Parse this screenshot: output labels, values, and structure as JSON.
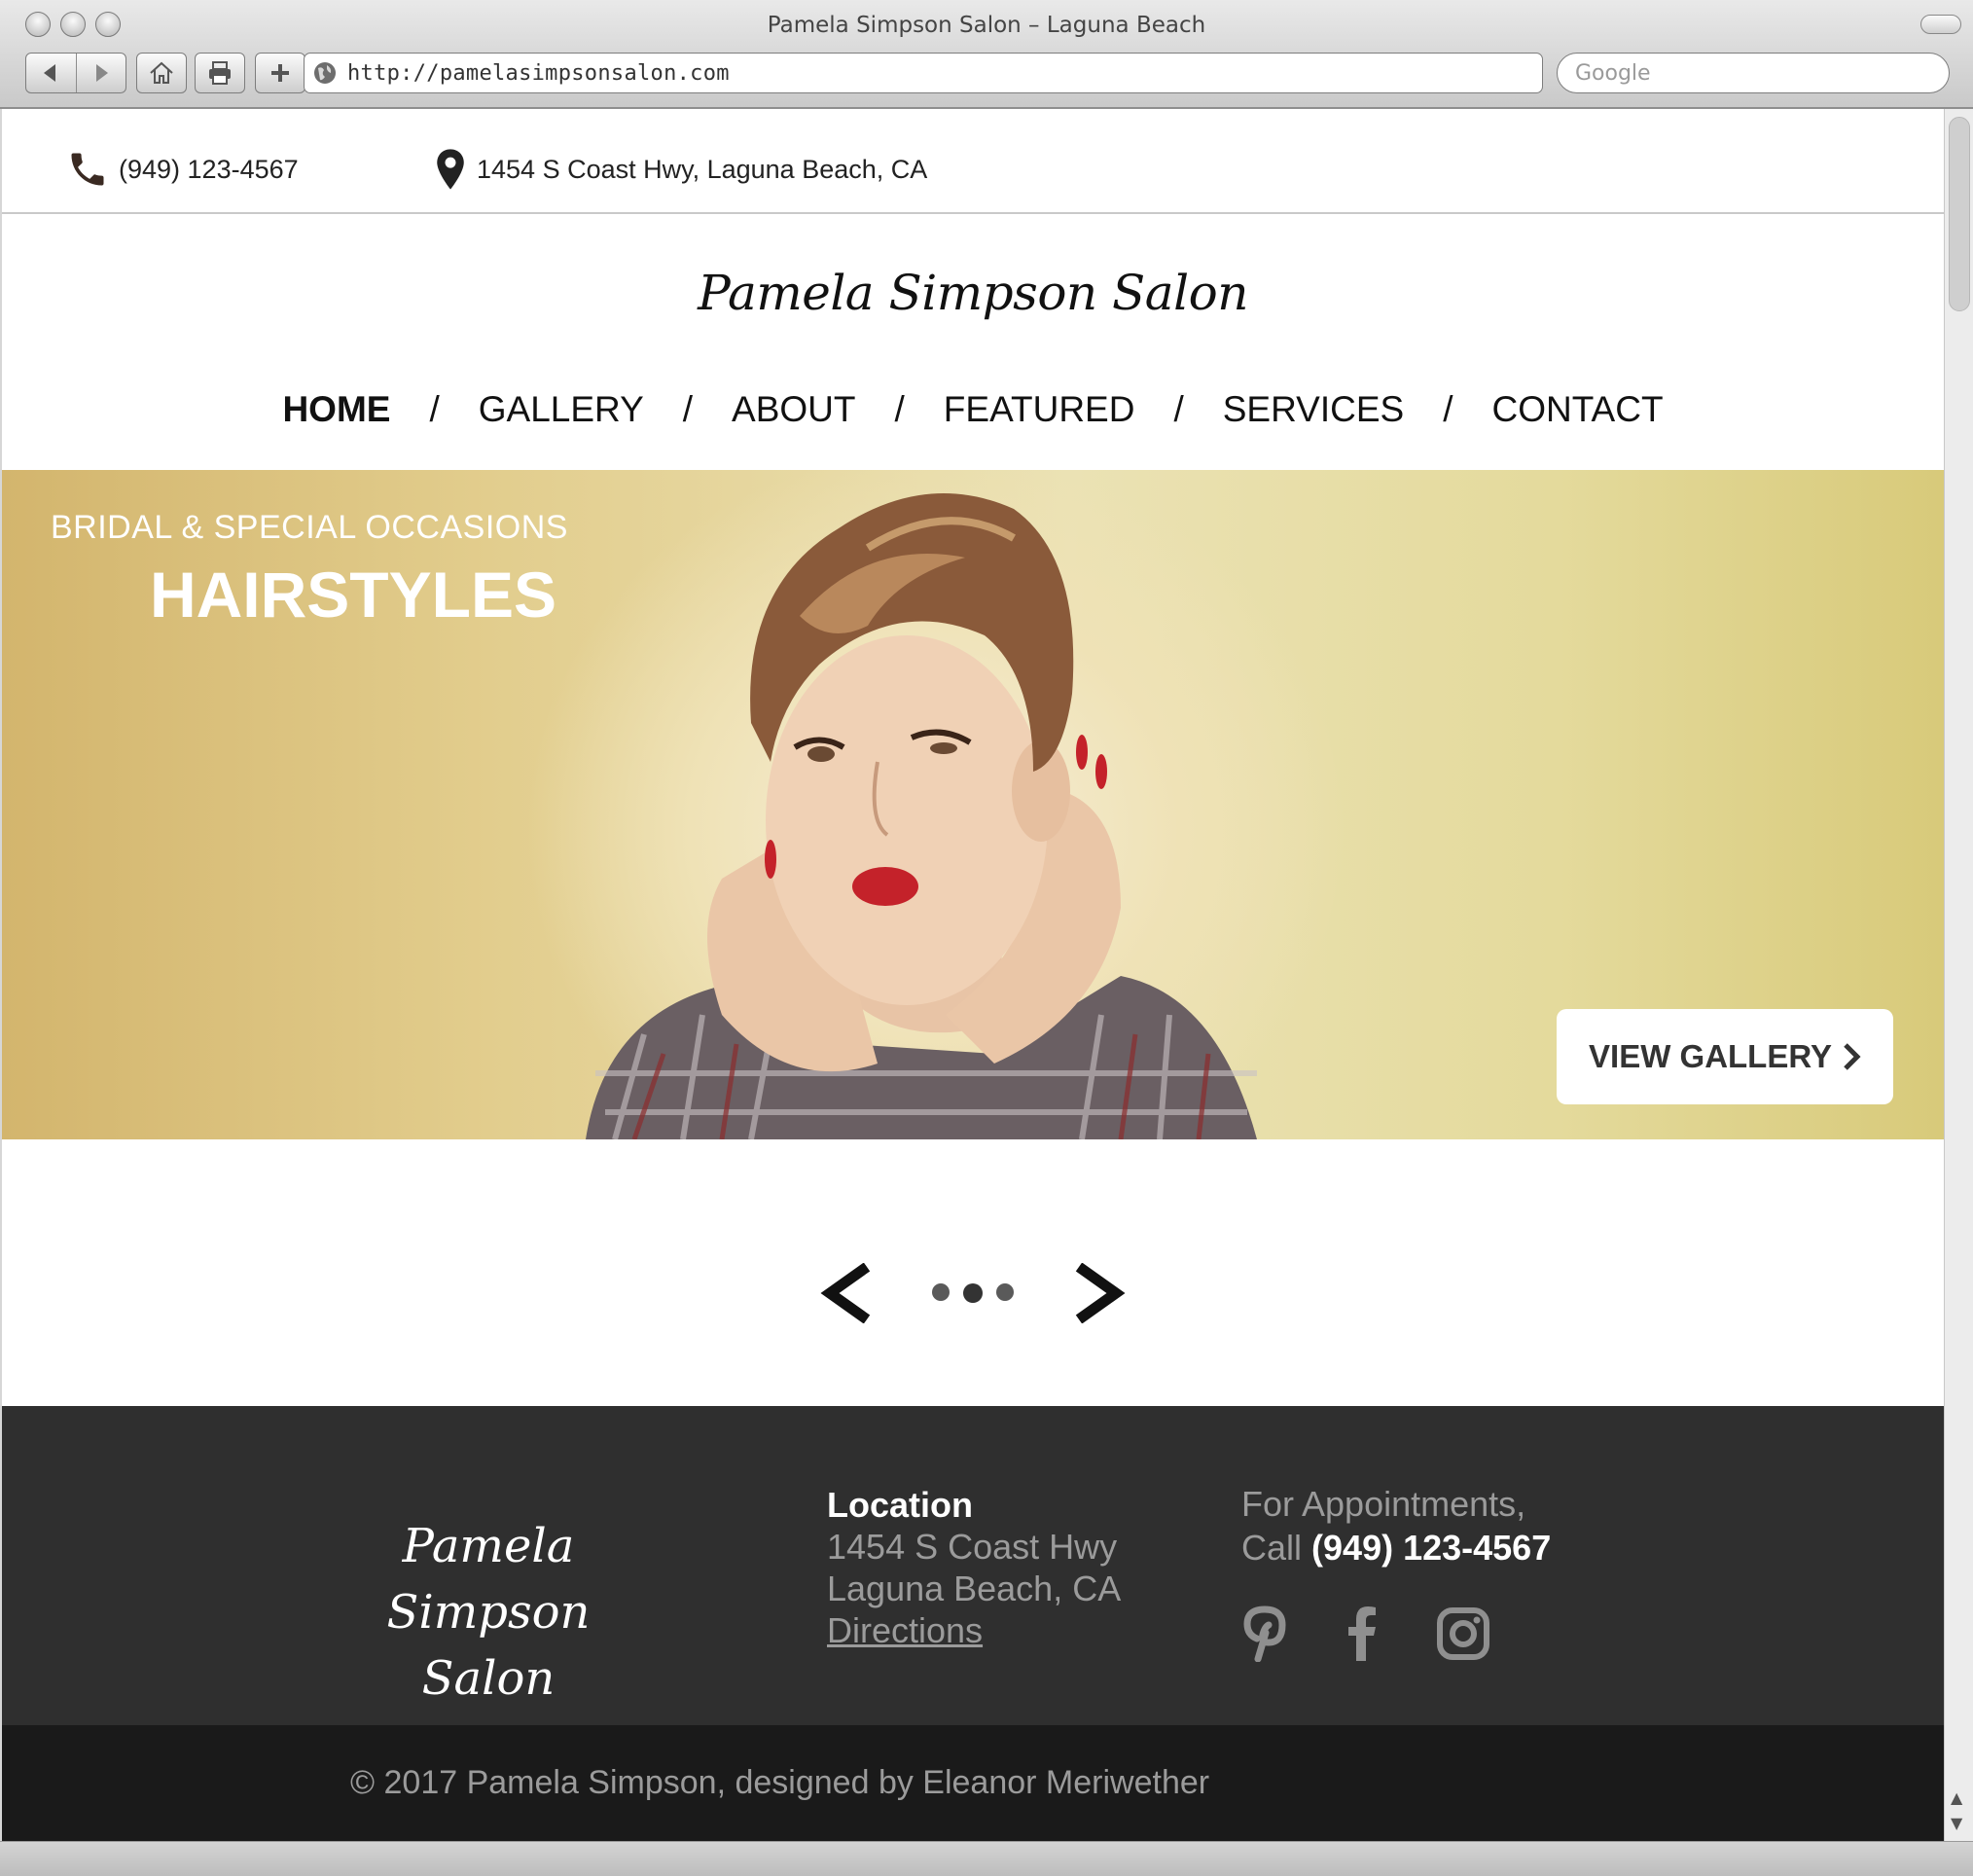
{
  "window": {
    "title": "Pamela Simpson Salon – Laguna Beach",
    "url": "http://pamelasimpsonsalon.com",
    "search_placeholder": "Google"
  },
  "topbar": {
    "phone": "(949) 123-4567",
    "address": "1454 S Coast Hwy, Laguna Beach, CA"
  },
  "site": {
    "logo": "Pamela Simpson Salon"
  },
  "nav": {
    "items": [
      {
        "label": "HOME",
        "active": true
      },
      {
        "label": "GALLERY"
      },
      {
        "label": "ABOUT"
      },
      {
        "label": "FEATURED"
      },
      {
        "label": "SERVICES"
      },
      {
        "label": "CONTACT"
      }
    ],
    "separator": "/"
  },
  "hero": {
    "subtitle": "BRIDAL & SPECIAL OCCASIONS",
    "title": "HAIRSTYLES",
    "button_label": "VIEW GALLERY"
  },
  "carousel": {
    "slide_count": 3,
    "active_index": 1
  },
  "footer": {
    "logo_line1": "Pamela Simpson",
    "logo_line2": "Salon",
    "location_heading": "Location",
    "address_line1": "1454 S Coast Hwy",
    "address_line2": "Laguna Beach, CA",
    "directions_label": "Directions",
    "appointments_line1": "For Appointments,",
    "appointments_call": "Call",
    "appointments_phone": "(949) 123-4567",
    "social_icons": [
      "pinterest-icon",
      "facebook-icon",
      "instagram-icon"
    ]
  },
  "copyright": {
    "text": "© 2017 Pamela Simpson, designed by Eleanor Meriwether"
  },
  "colors": {
    "footer_bg": "#2f2f2f",
    "copyright_bg": "#1a1a1a",
    "hero_gold": "#d3b56d",
    "hero_light": "#ebe2b4"
  }
}
